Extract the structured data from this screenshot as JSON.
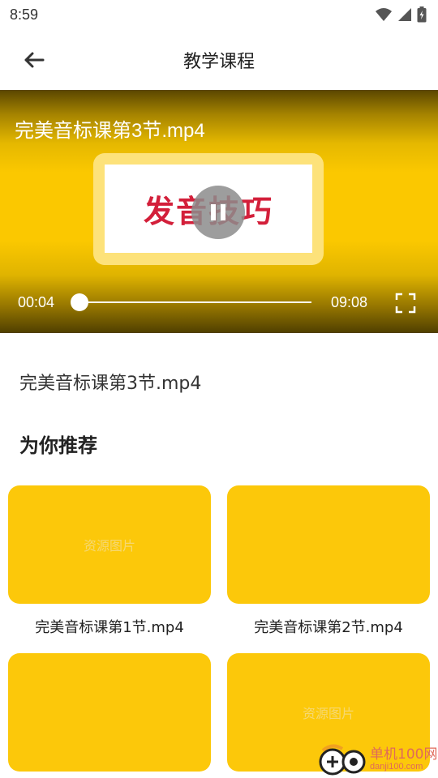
{
  "status_bar": {
    "time": "8:59",
    "icons": [
      "wifi-icon",
      "signal-icon",
      "battery-icon"
    ]
  },
  "app_bar": {
    "title": "教学课程",
    "back_icon": "arrow-left-icon"
  },
  "player": {
    "title": "完美音标课第3节.mp4",
    "thumbnail_text": "发音技巧",
    "current_time": "00:04",
    "total_time": "09:08",
    "progress_fraction": 0.007,
    "state": "playing",
    "pause_icon": "pause-icon",
    "fullscreen_icon": "fullscreen-icon"
  },
  "current_video": {
    "name": "完美音标课第3节.mp4"
  },
  "recommend": {
    "title": "为你推荐",
    "items": [
      {
        "label": "完美音标课第1节.mp4",
        "thumb_text": "资源图片"
      },
      {
        "label": "完美音标课第2节.mp4",
        "thumb_text": ""
      },
      {
        "label": "",
        "thumb_text": ""
      },
      {
        "label": "",
        "thumb_text": "资源图片"
      }
    ]
  },
  "watermark": {
    "line1": "单机100网",
    "line2": "danji100.com"
  },
  "colors": {
    "accent_yellow": "#fcc80a",
    "thumb_red": "#d31f3a"
  }
}
